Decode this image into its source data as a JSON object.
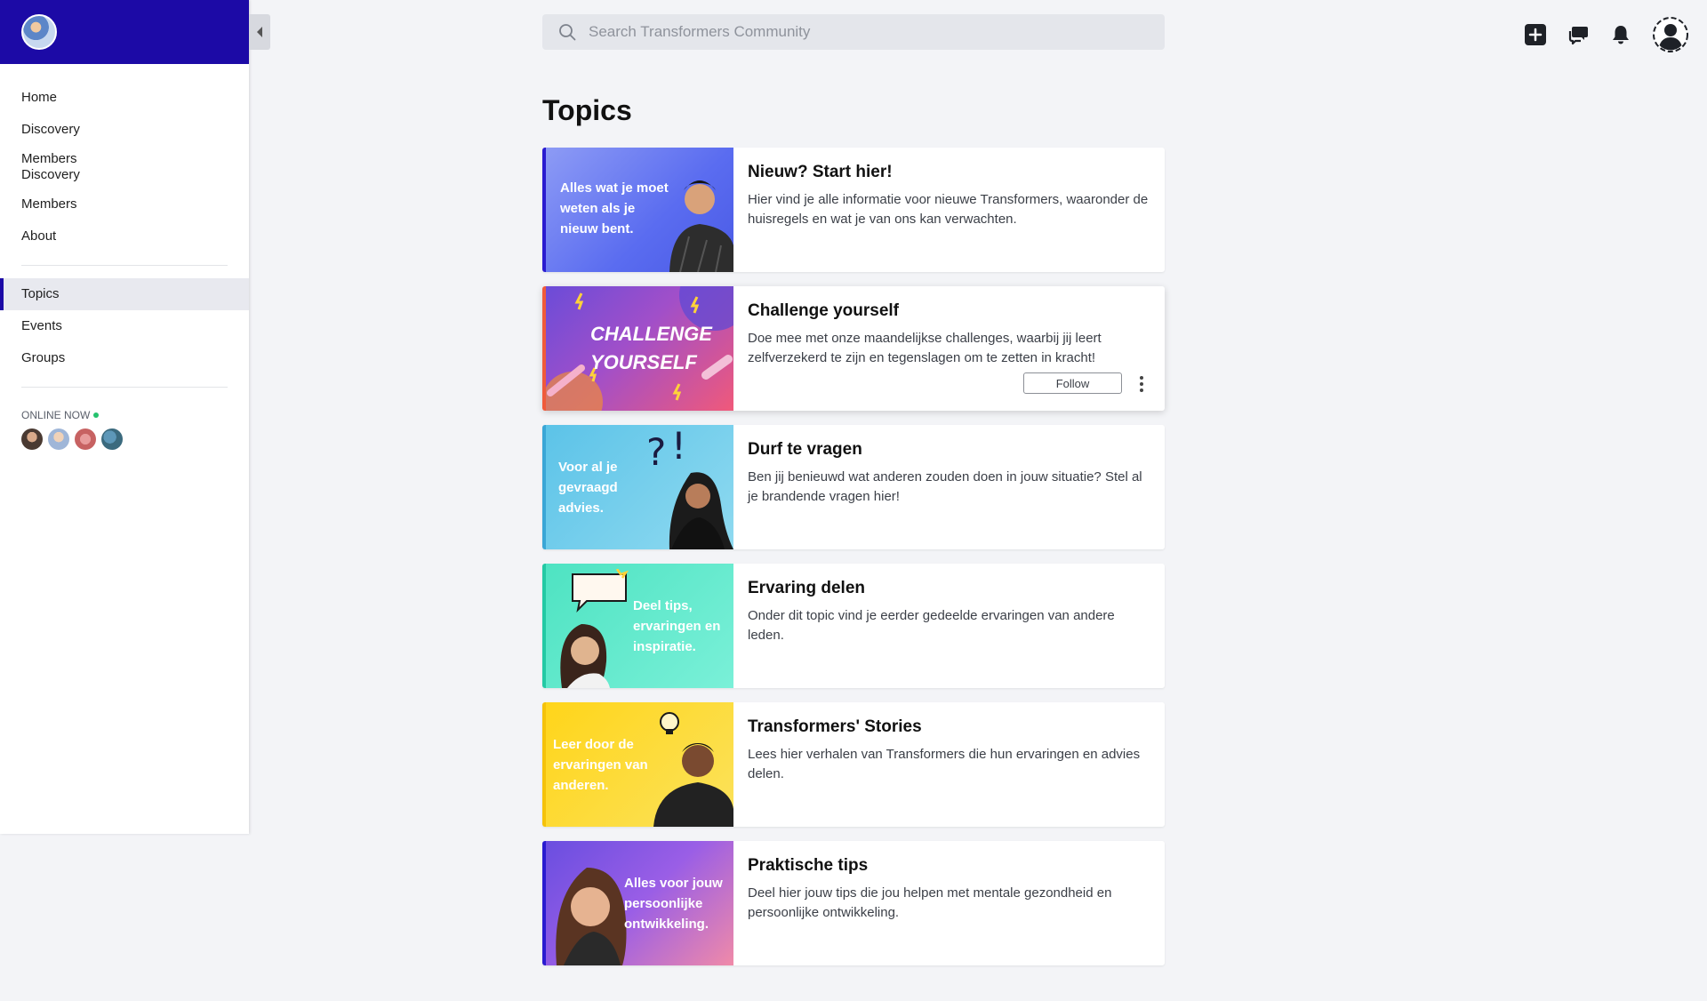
{
  "app": {
    "logo_icon": "community-logo"
  },
  "sidebar": {
    "nav_primary": [
      {
        "label": "Home"
      },
      {
        "label": "Discovery"
      },
      {
        "label": "Members\nDiscovery"
      },
      {
        "label": "Members"
      },
      {
        "label": "About"
      }
    ],
    "nav_secondary": [
      {
        "label": "Topics",
        "active": true
      },
      {
        "label": "Events"
      },
      {
        "label": "Groups"
      }
    ],
    "online_now_label": "ONLINE NOW"
  },
  "search": {
    "placeholder": "Search Transformers Community"
  },
  "topbar_icons": [
    "plus-square-icon",
    "chat-bubbles-icon",
    "bell-icon",
    "user-avatar-icon"
  ],
  "main": {
    "title": "Topics",
    "topics": [
      {
        "thumb_text": "Alles wat je moet weten als je nieuw bent.",
        "title": "Nieuw? Start hier!",
        "description": "Hier vind je alle informatie voor nieuwe Transformers, waaronder de huisregels en wat je van ons kan verwachten."
      },
      {
        "thumb_text": "CHALLENGE YOURSELF",
        "title": "Challenge yourself",
        "description": "Doe mee met onze maandelijkse challenges, waarbij jij leert zelfverzekerd te zijn en tegenslagen om te zetten in kracht!",
        "follow_label": "Follow"
      },
      {
        "thumb_text": "Voor al je gevraagd advies.",
        "title": "Durf te vragen",
        "description": "Ben jij benieuwd wat anderen zouden doen in jouw situatie? Stel al je brandende vragen hier!"
      },
      {
        "thumb_text": "Deel tips, ervaringen en inspiratie.",
        "title": "Ervaring delen",
        "description": "Onder dit topic vind je eerder gedeelde ervaringen van andere leden."
      },
      {
        "thumb_text": "Leer door de ervaringen van anderen.",
        "title": "Transformers' Stories",
        "description": "Lees hier verhalen van Transformers die hun ervaringen en advies delen."
      },
      {
        "thumb_text": "Alles voor jouw persoonlijke ontwikkeling.",
        "title": "Praktische tips",
        "description": "Deel hier jouw tips die jou helpen met mentale gezondheid en persoonlijke ontwikkeling."
      }
    ]
  },
  "colors": {
    "brand": "#1c0aa6",
    "online": "#25c26e"
  }
}
